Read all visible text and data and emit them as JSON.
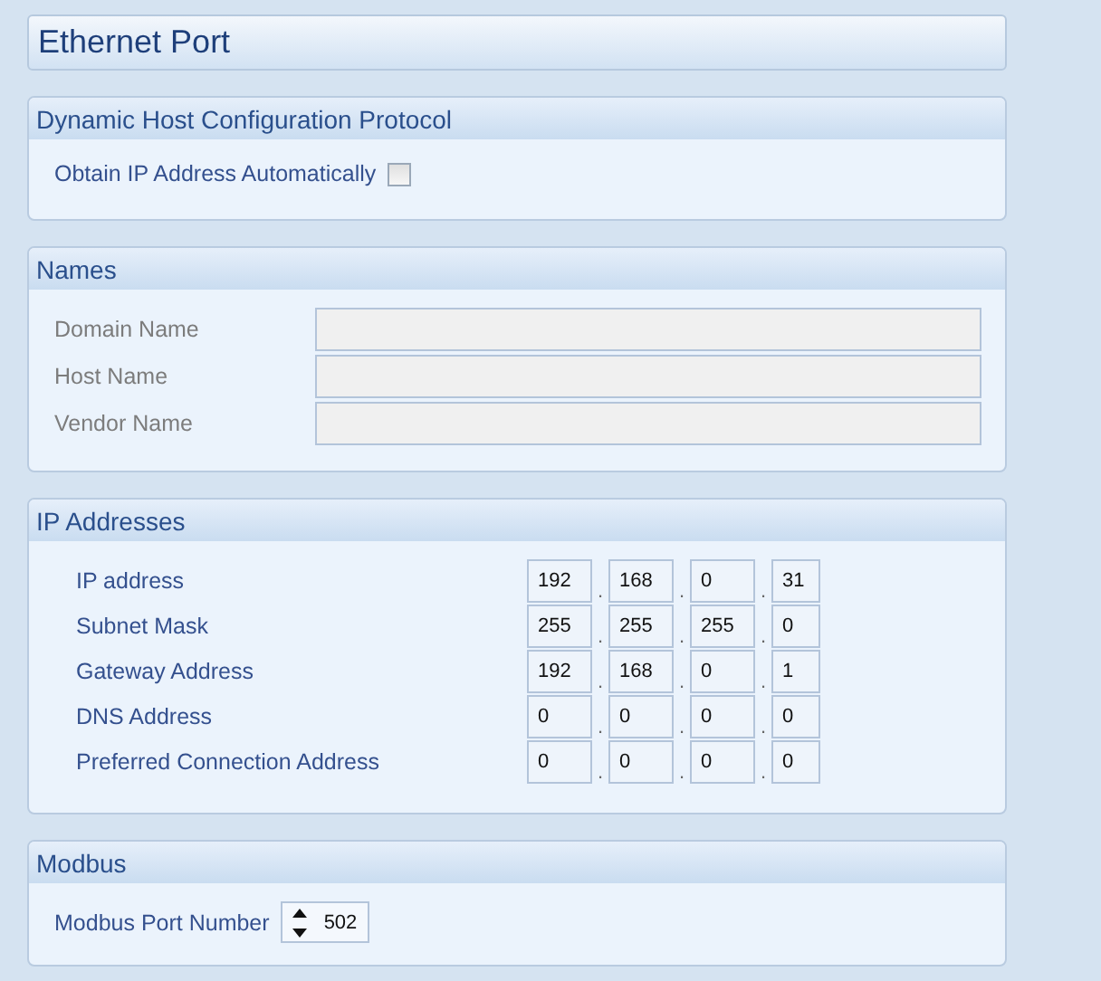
{
  "window": {
    "title": "Ethernet Port"
  },
  "sections": [
    {
      "kind": "checkbox",
      "title": "Dynamic Host Configuration Protocol",
      "label": "Obtain IP Address Automatically",
      "checked": false
    },
    {
      "kind": "text_fields",
      "title": "Names",
      "fields": [
        {
          "label": "Domain Name",
          "disabled": true
        },
        {
          "label": "Host Name",
          "disabled": true
        },
        {
          "label": "Vendor Name",
          "disabled": true
        }
      ]
    },
    {
      "kind": "ip_table",
      "title": "IP Addresses",
      "separator": ".",
      "rows": [
        {
          "label": "IP address",
          "octets": [
            "192",
            "168",
            "0",
            "31"
          ]
        },
        {
          "label": "Subnet Mask",
          "octets": [
            "255",
            "255",
            "255",
            "0"
          ]
        },
        {
          "label": "Gateway Address",
          "octets": [
            "192",
            "168",
            "0",
            "1"
          ]
        },
        {
          "label": "DNS Address",
          "octets": [
            "0",
            "0",
            "0",
            "0"
          ]
        },
        {
          "label": "Preferred Connection Address",
          "octets": [
            "0",
            "0",
            "0",
            "0"
          ]
        }
      ]
    },
    {
      "kind": "spinner",
      "title": "Modbus",
      "label": "Modbus Port Number",
      "value": "502"
    }
  ]
}
